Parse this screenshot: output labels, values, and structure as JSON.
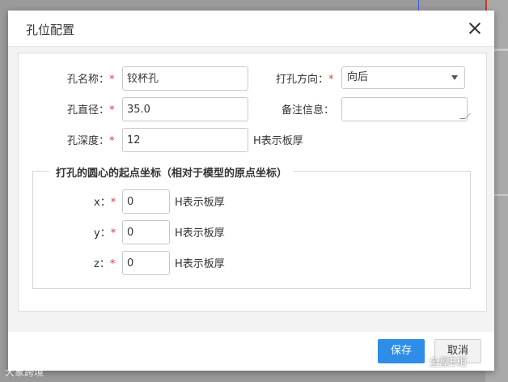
{
  "dialog": {
    "title": "孔位配置"
  },
  "form": {
    "hole_name": {
      "label": "孔名称：",
      "required": "*",
      "value": "铰杯孔"
    },
    "drill_direction": {
      "label": "打孔方向：",
      "required": "*",
      "selected": "向后"
    },
    "hole_diameter": {
      "label": "孔直径：",
      "required": "*",
      "value": "35.0"
    },
    "remark": {
      "label": "备注信息：",
      "value": ""
    },
    "hole_depth": {
      "label": "孔深度：",
      "required": "*",
      "value": "12",
      "unit": "H表示板厚"
    }
  },
  "origin_group": {
    "legend": "打孔的圆心的起点坐标（相对于模型的原点坐标）",
    "x": {
      "label": "x：",
      "required": "*",
      "value": "0",
      "unit": "H表示板厚"
    },
    "y": {
      "label": "y：",
      "required": "*",
      "value": "0",
      "unit": "H表示板厚"
    },
    "z": {
      "label": "z：",
      "required": "*",
      "value": "0",
      "unit": "H表示板厚"
    }
  },
  "footer": {
    "save_label": "保存",
    "cancel_label": "取消"
  },
  "watermarks": {
    "left": "大象跨境",
    "right": "全屋E柜"
  },
  "colors": {
    "primary": "#2e8de6",
    "required": "#e4393c",
    "overlay_bg": "#9a9a9a"
  }
}
